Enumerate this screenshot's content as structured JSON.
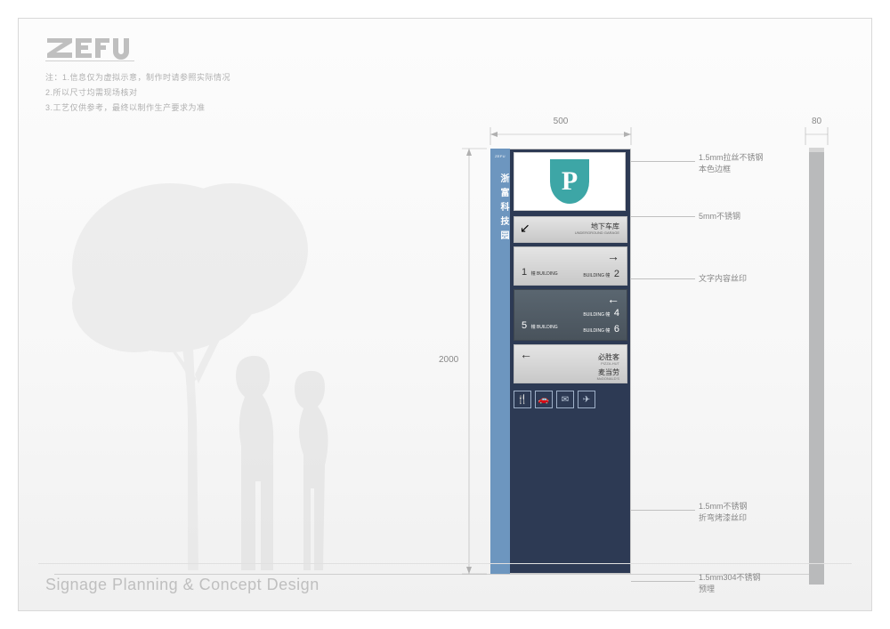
{
  "brand": "ZEFU",
  "notes": [
    "注：1.信息仅为虚拟示意，制作时请参照实际情况",
    "2.所以尺寸均需现场核对",
    "3.工艺仅供参考，最终以制作生产要求为准"
  ],
  "footer": "Signage Planning & Concept Design",
  "dimensions": {
    "width": "500",
    "height": "2000",
    "depth": "80"
  },
  "callouts": {
    "c1a": "1.5mm拉丝不锈钢",
    "c1b": "本色边框",
    "c2": "5mm不锈钢",
    "c3": "文字内容丝印",
    "c4a": "1.5mm不锈钢",
    "c4b": "折弯烤漆丝印",
    "c5a": "1.5mm304不锈钢",
    "c5b": "预埋"
  },
  "sign": {
    "brand_mini": "ZEFU",
    "vertical": "浙富科技园",
    "p": "P",
    "s1": {
      "arrow": "↙",
      "cn": "地下车库",
      "en": "UNDERGROUND GARAGE"
    },
    "s2": {
      "arrow": "→",
      "n1": "1",
      "b1": "幢 BUILDING",
      "b2": "BUILDING 幢",
      "n2": "2"
    },
    "s3": {
      "arrow": "←",
      "b3": "BUILDING 幢",
      "n4": "4",
      "n5": "5",
      "b5": "幢 BUILDING",
      "b6": "BUILDING 幢",
      "n6": "6"
    },
    "s4": {
      "arrow": "←",
      "r1cn": "必胜客",
      "r1en": "PIZZA-HUT",
      "r2cn": "麦当劳",
      "r2en": "McDONALD'S"
    },
    "icons": [
      "🍴",
      "🚗",
      "✉",
      "✈"
    ]
  }
}
